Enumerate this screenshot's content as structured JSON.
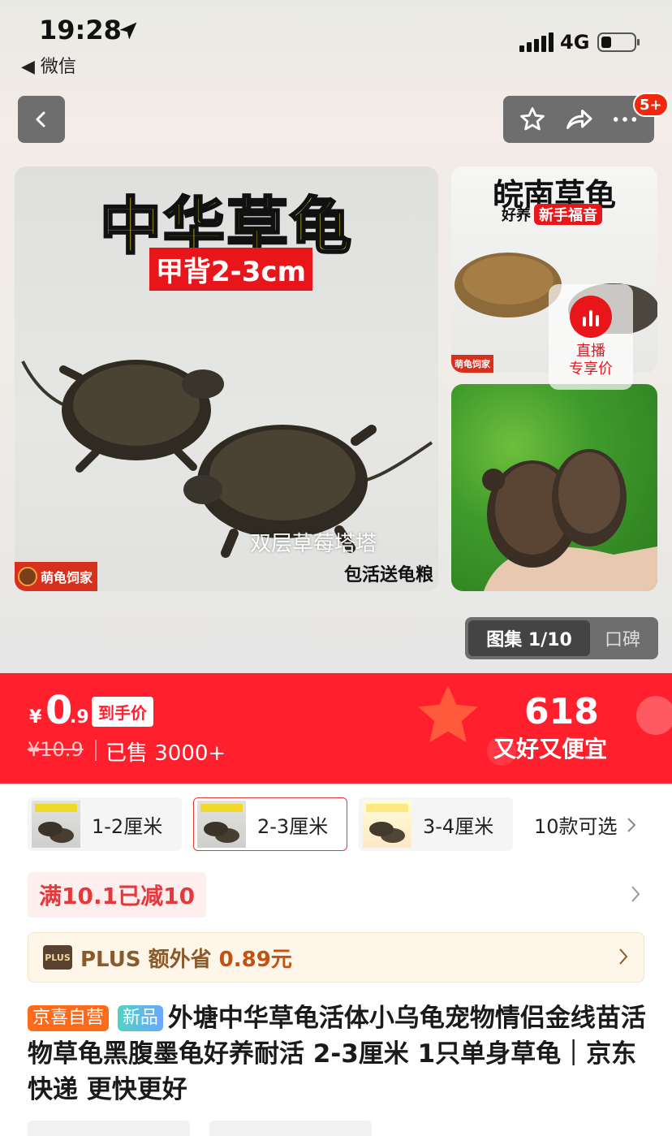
{
  "status_bar": {
    "time": "19:28",
    "back_app": "◀ 微信",
    "network": "4G"
  },
  "nav": {
    "badge": "5+"
  },
  "gallery": {
    "main_title": "中华草龟",
    "main_subtitle": "甲背2-3cm",
    "main_watermark": "双层草莓塔塔",
    "main_brand": "萌龟饲家",
    "main_footer": "包活送龟粮",
    "side1_title": "皖南草龟",
    "side1_tag_plain": "好养",
    "side1_tag_red": "新手福音",
    "side1_brand": "萌龟饲家",
    "live_label_1": "直播",
    "live_label_2": "专享价",
    "switch_active": "图集 1/10",
    "switch_other": "口碑"
  },
  "price": {
    "currency": "¥",
    "int_part": "0",
    "dec_part": ".9",
    "tag": "到手价",
    "original": "¥10.9",
    "sold": "已售 3000+",
    "promo_number": "618",
    "promo_slogan": "又好又便宜",
    "colors": {
      "banner": "#ff1f2d"
    }
  },
  "variants": {
    "items": [
      {
        "label": "1-2厘米",
        "selected": false
      },
      {
        "label": "2-3厘米",
        "selected": true
      },
      {
        "label": "3-4厘米",
        "selected": false
      }
    ],
    "more_label": "10款可选"
  },
  "coupon": {
    "label": "满10.1已减10"
  },
  "plus": {
    "logo": "PLUS",
    "text": "PLUS 额外省 ",
    "amount": "0.89元"
  },
  "product": {
    "tag_jx": "京喜自营",
    "tag_new": "新品",
    "title": "外塘中华草龟活体小乌龟宠物情侣金线苗活物草龟黑腹墨龟好养耐活 2-3厘米 1只单身草龟｜京东快递 更快更好"
  }
}
